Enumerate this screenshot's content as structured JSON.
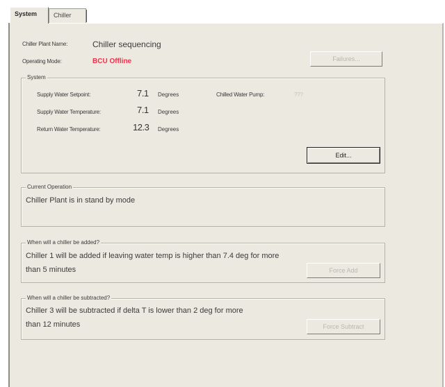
{
  "tabs": [
    {
      "label": "System"
    },
    {
      "label": "Chiller"
    }
  ],
  "header": {
    "plant_name_label": "Chiller Plant Name:",
    "plant_name_value": "Chiller sequencing",
    "mode_label": "Operating Mode:",
    "mode_value": "BCU Offline",
    "failures_button": "Failures..."
  },
  "system": {
    "title": "System",
    "rows": [
      {
        "label": "Supply Water Setpoint:",
        "value": "7.1",
        "unit": "Degrees"
      },
      {
        "label": "Supply Water Temperature:",
        "value": "7.1",
        "unit": "Degrees"
      },
      {
        "label": "Return Water Temperature:",
        "value": "12.3",
        "unit": "Degrees"
      }
    ],
    "pump_label": "Chilled Water Pump:",
    "pump_value": "???",
    "edit_button": "Edit..."
  },
  "current_operation": {
    "title": "Current Operation",
    "text": "Chiller Plant is in stand by mode"
  },
  "add": {
    "title": "When will a chiller be added?",
    "line1": "Chiller 1 will be added if leaving water temp is higher than 7.4 deg for more",
    "line2": "than 5 minutes",
    "button": "Force Add"
  },
  "subtract": {
    "title": "When will a chiller be subtracted?",
    "line1": "Chiller 3 will be subtracted if delta T is lower than 2 deg for more",
    "line2": "than 12 minutes",
    "button": "Force Subtract"
  },
  "colors": {
    "panel_bg": "#ece9e1",
    "mode_text": "#f0304a",
    "disabled_text": "#b9b7b0"
  }
}
